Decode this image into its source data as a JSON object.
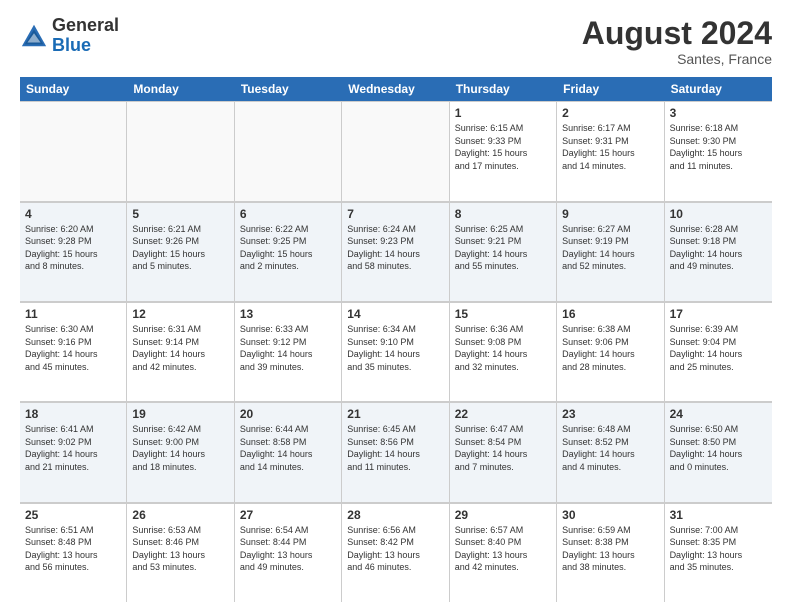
{
  "header": {
    "logo_general": "General",
    "logo_blue": "Blue",
    "month_year": "August 2024",
    "location": "Santes, France"
  },
  "days_of_week": [
    "Sunday",
    "Monday",
    "Tuesday",
    "Wednesday",
    "Thursday",
    "Friday",
    "Saturday"
  ],
  "weeks": [
    [
      {
        "day": "",
        "content": ""
      },
      {
        "day": "",
        "content": ""
      },
      {
        "day": "",
        "content": ""
      },
      {
        "day": "",
        "content": ""
      },
      {
        "day": "1",
        "content": "Sunrise: 6:15 AM\nSunset: 9:33 PM\nDaylight: 15 hours\nand 17 minutes."
      },
      {
        "day": "2",
        "content": "Sunrise: 6:17 AM\nSunset: 9:31 PM\nDaylight: 15 hours\nand 14 minutes."
      },
      {
        "day": "3",
        "content": "Sunrise: 6:18 AM\nSunset: 9:30 PM\nDaylight: 15 hours\nand 11 minutes."
      }
    ],
    [
      {
        "day": "4",
        "content": "Sunrise: 6:20 AM\nSunset: 9:28 PM\nDaylight: 15 hours\nand 8 minutes."
      },
      {
        "day": "5",
        "content": "Sunrise: 6:21 AM\nSunset: 9:26 PM\nDaylight: 15 hours\nand 5 minutes."
      },
      {
        "day": "6",
        "content": "Sunrise: 6:22 AM\nSunset: 9:25 PM\nDaylight: 15 hours\nand 2 minutes."
      },
      {
        "day": "7",
        "content": "Sunrise: 6:24 AM\nSunset: 9:23 PM\nDaylight: 14 hours\nand 58 minutes."
      },
      {
        "day": "8",
        "content": "Sunrise: 6:25 AM\nSunset: 9:21 PM\nDaylight: 14 hours\nand 55 minutes."
      },
      {
        "day": "9",
        "content": "Sunrise: 6:27 AM\nSunset: 9:19 PM\nDaylight: 14 hours\nand 52 minutes."
      },
      {
        "day": "10",
        "content": "Sunrise: 6:28 AM\nSunset: 9:18 PM\nDaylight: 14 hours\nand 49 minutes."
      }
    ],
    [
      {
        "day": "11",
        "content": "Sunrise: 6:30 AM\nSunset: 9:16 PM\nDaylight: 14 hours\nand 45 minutes."
      },
      {
        "day": "12",
        "content": "Sunrise: 6:31 AM\nSunset: 9:14 PM\nDaylight: 14 hours\nand 42 minutes."
      },
      {
        "day": "13",
        "content": "Sunrise: 6:33 AM\nSunset: 9:12 PM\nDaylight: 14 hours\nand 39 minutes."
      },
      {
        "day": "14",
        "content": "Sunrise: 6:34 AM\nSunset: 9:10 PM\nDaylight: 14 hours\nand 35 minutes."
      },
      {
        "day": "15",
        "content": "Sunrise: 6:36 AM\nSunset: 9:08 PM\nDaylight: 14 hours\nand 32 minutes."
      },
      {
        "day": "16",
        "content": "Sunrise: 6:38 AM\nSunset: 9:06 PM\nDaylight: 14 hours\nand 28 minutes."
      },
      {
        "day": "17",
        "content": "Sunrise: 6:39 AM\nSunset: 9:04 PM\nDaylight: 14 hours\nand 25 minutes."
      }
    ],
    [
      {
        "day": "18",
        "content": "Sunrise: 6:41 AM\nSunset: 9:02 PM\nDaylight: 14 hours\nand 21 minutes."
      },
      {
        "day": "19",
        "content": "Sunrise: 6:42 AM\nSunset: 9:00 PM\nDaylight: 14 hours\nand 18 minutes."
      },
      {
        "day": "20",
        "content": "Sunrise: 6:44 AM\nSunset: 8:58 PM\nDaylight: 14 hours\nand 14 minutes."
      },
      {
        "day": "21",
        "content": "Sunrise: 6:45 AM\nSunset: 8:56 PM\nDaylight: 14 hours\nand 11 minutes."
      },
      {
        "day": "22",
        "content": "Sunrise: 6:47 AM\nSunset: 8:54 PM\nDaylight: 14 hours\nand 7 minutes."
      },
      {
        "day": "23",
        "content": "Sunrise: 6:48 AM\nSunset: 8:52 PM\nDaylight: 14 hours\nand 4 minutes."
      },
      {
        "day": "24",
        "content": "Sunrise: 6:50 AM\nSunset: 8:50 PM\nDaylight: 14 hours\nand 0 minutes."
      }
    ],
    [
      {
        "day": "25",
        "content": "Sunrise: 6:51 AM\nSunset: 8:48 PM\nDaylight: 13 hours\nand 56 minutes."
      },
      {
        "day": "26",
        "content": "Sunrise: 6:53 AM\nSunset: 8:46 PM\nDaylight: 13 hours\nand 53 minutes."
      },
      {
        "day": "27",
        "content": "Sunrise: 6:54 AM\nSunset: 8:44 PM\nDaylight: 13 hours\nand 49 minutes."
      },
      {
        "day": "28",
        "content": "Sunrise: 6:56 AM\nSunset: 8:42 PM\nDaylight: 13 hours\nand 46 minutes."
      },
      {
        "day": "29",
        "content": "Sunrise: 6:57 AM\nSunset: 8:40 PM\nDaylight: 13 hours\nand 42 minutes."
      },
      {
        "day": "30",
        "content": "Sunrise: 6:59 AM\nSunset: 8:38 PM\nDaylight: 13 hours\nand 38 minutes."
      },
      {
        "day": "31",
        "content": "Sunrise: 7:00 AM\nSunset: 8:35 PM\nDaylight: 13 hours\nand 35 minutes."
      }
    ]
  ]
}
